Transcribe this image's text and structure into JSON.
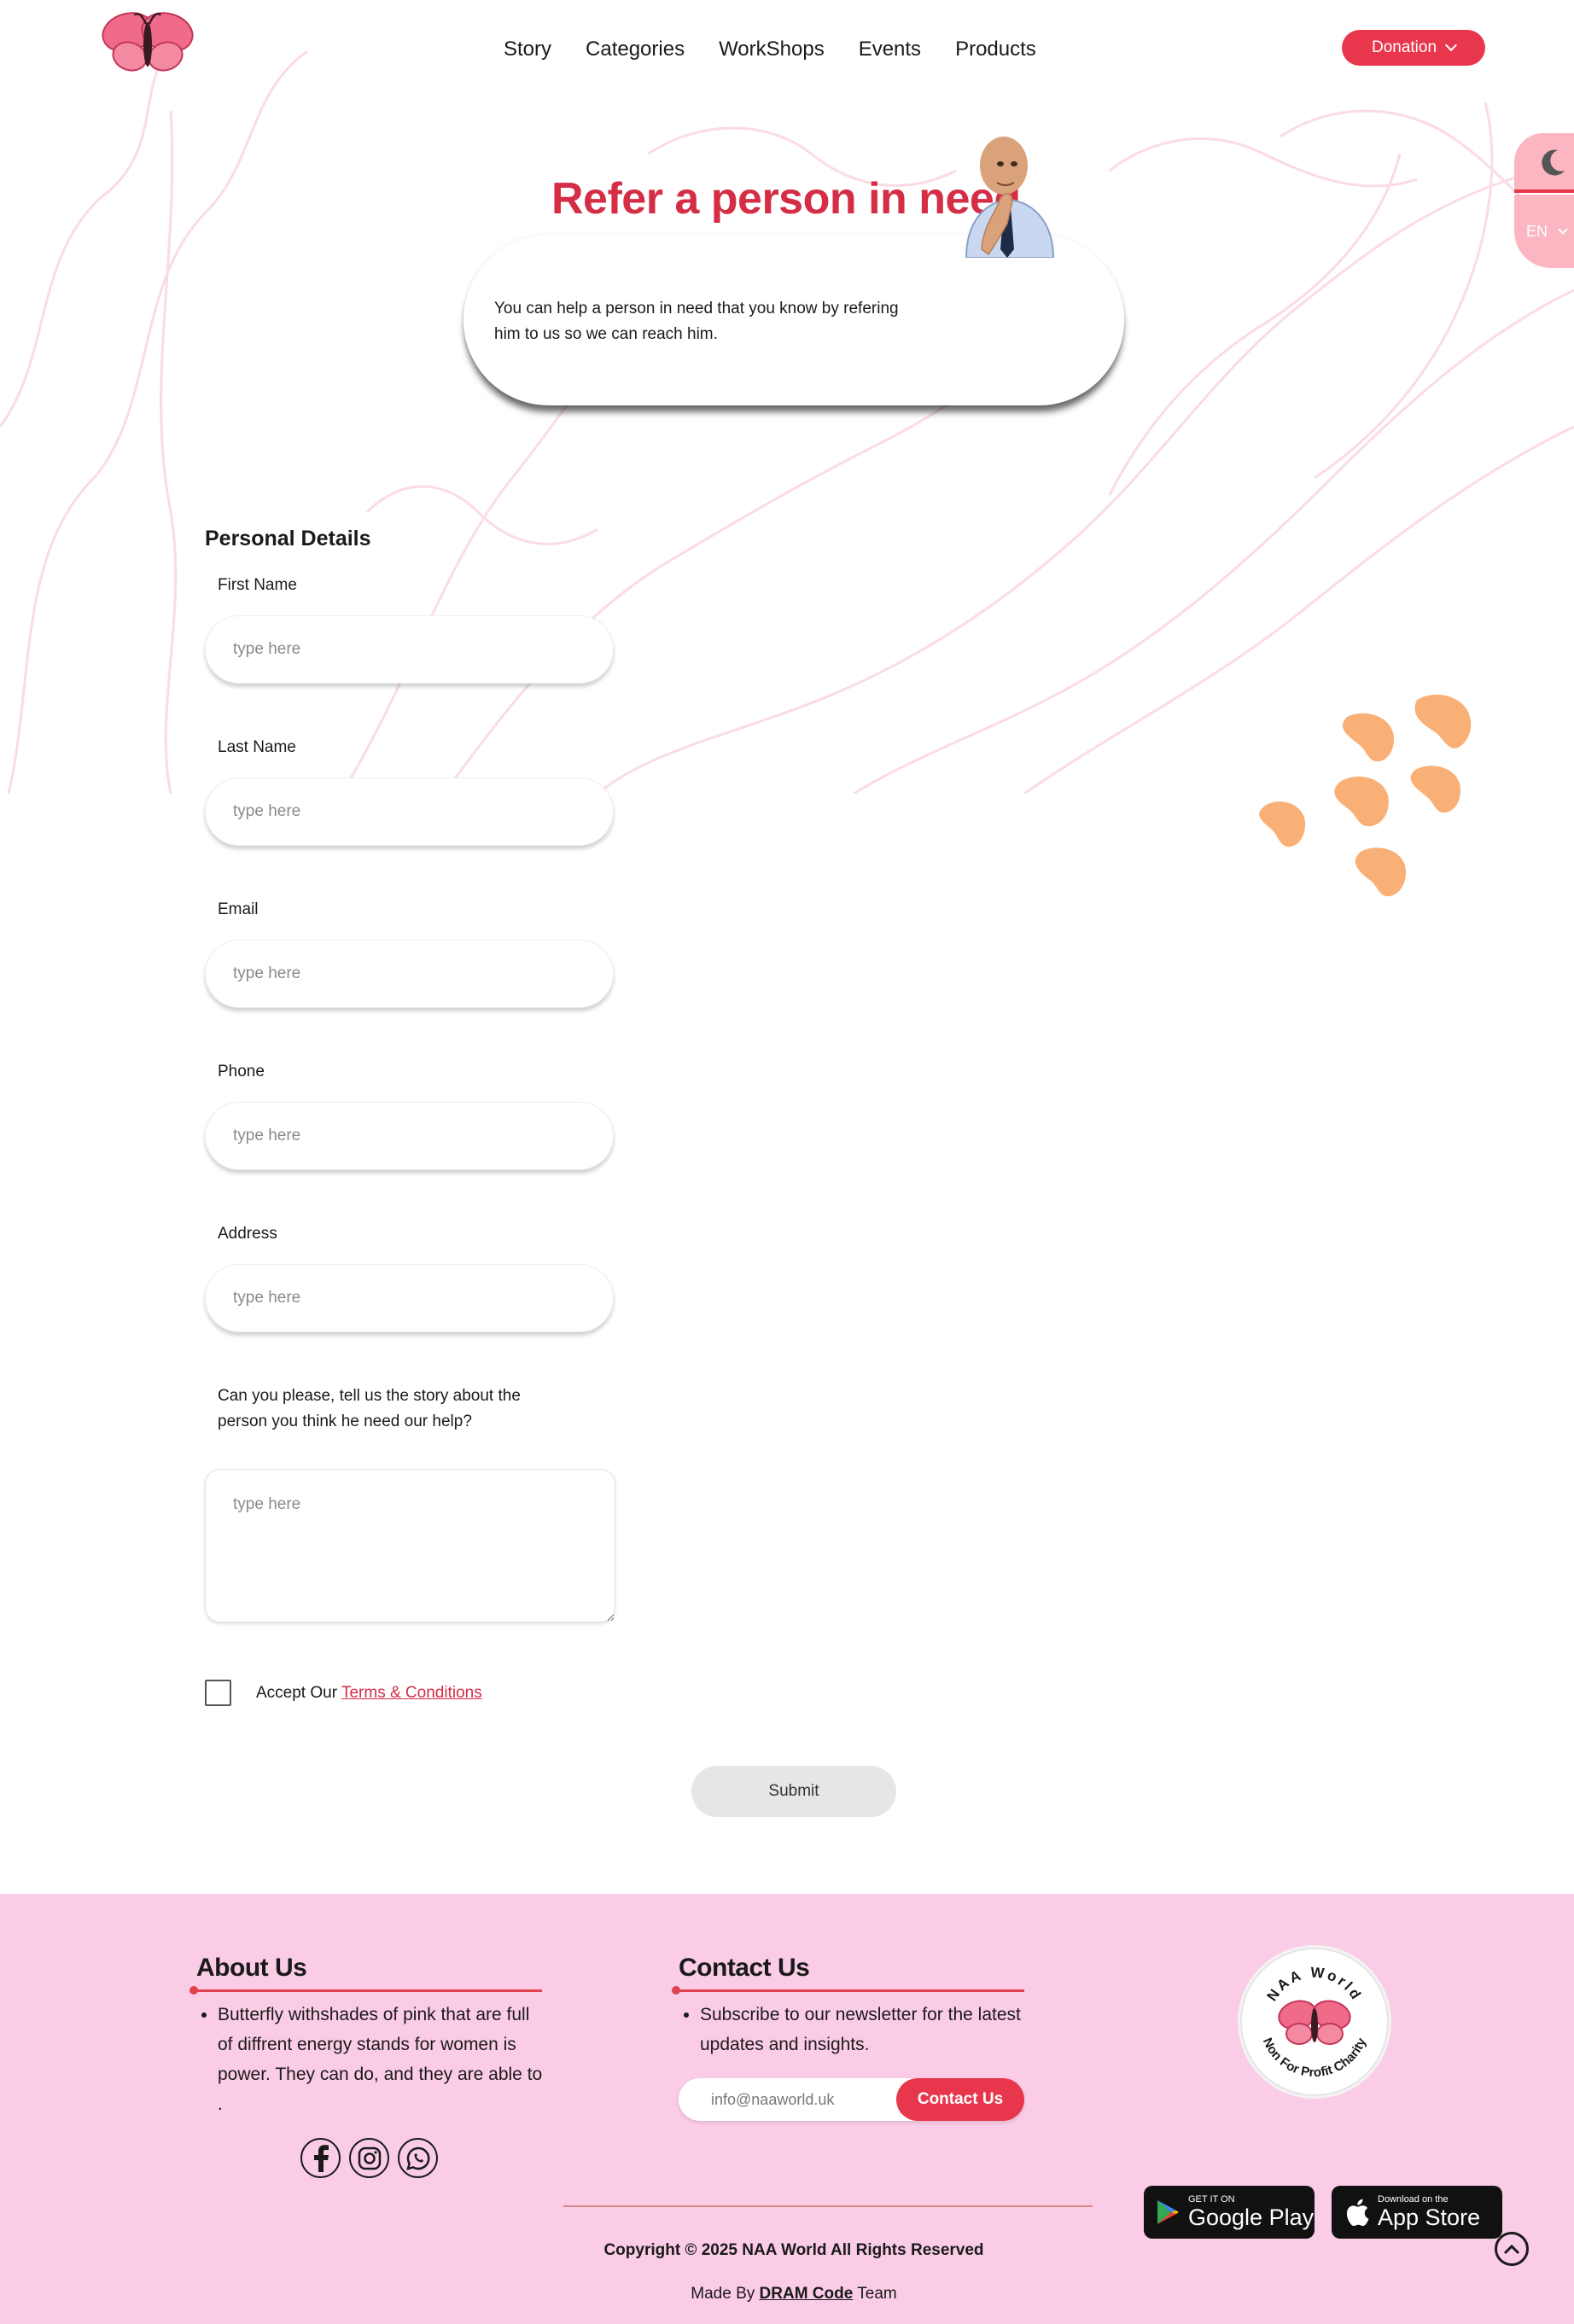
{
  "header": {
    "nav": [
      "Story",
      "Categories",
      "WorkShops",
      "Events",
      "Products"
    ],
    "donation_label": "Donation",
    "language": "EN"
  },
  "hero": {
    "title": "Refer a person in need",
    "description": "You can help a person in need that you know by refering him to us so we can reach him."
  },
  "form": {
    "section_title": "Personal Details",
    "fields": [
      {
        "label": "First Name",
        "placeholder": "type here"
      },
      {
        "label": "Last Name",
        "placeholder": "type here"
      },
      {
        "label": "Email",
        "placeholder": "type here"
      },
      {
        "label": "Phone",
        "placeholder": "type here"
      },
      {
        "label": "Address",
        "placeholder": "type here"
      }
    ],
    "story_label": "Can you please, tell us the story about the person you think he need our help?",
    "story_placeholder": "type here",
    "terms_prefix": "Accept Our",
    "terms_link": "Terms & Conditions",
    "submit_label": "Submit"
  },
  "footer": {
    "about_heading": "About Us",
    "about_text": "Butterfly withshades of pink that are full of diffrent energy stands for women is power. They can do, and they are able to .",
    "contact_heading": "Contact Us",
    "contact_text": "Subscribe to our newsletter for the latest updates and insights.",
    "newsletter_placeholder": "info@naaworld.uk",
    "contact_button": "Contact Us",
    "logo_top_text": "NAA World",
    "logo_bottom_text": "Non For Profit Charity",
    "google_small": "GET IT ON",
    "google_big": "Google Play",
    "apple_small": "Download on the",
    "apple_big": "App Store",
    "copyright": "Copyright © 2025 NAA World All Rights Reserved",
    "made_by_prefix": "Made By",
    "made_by_link": "DRAM Code",
    "made_by_suffix": "Team"
  },
  "colors": {
    "accent": "#e8374d",
    "title_red": "#d42d45",
    "footer_bg": "#fbcce6",
    "side_panel_pink": "#fbb6c2",
    "blob_orange": "#f9b077"
  },
  "icons": [
    "butterfly-logo",
    "moon-icon",
    "chevron-down-icon",
    "facebook-icon",
    "instagram-icon",
    "whatsapp-icon",
    "google-play-icon",
    "apple-icon",
    "scroll-top-icon"
  ]
}
